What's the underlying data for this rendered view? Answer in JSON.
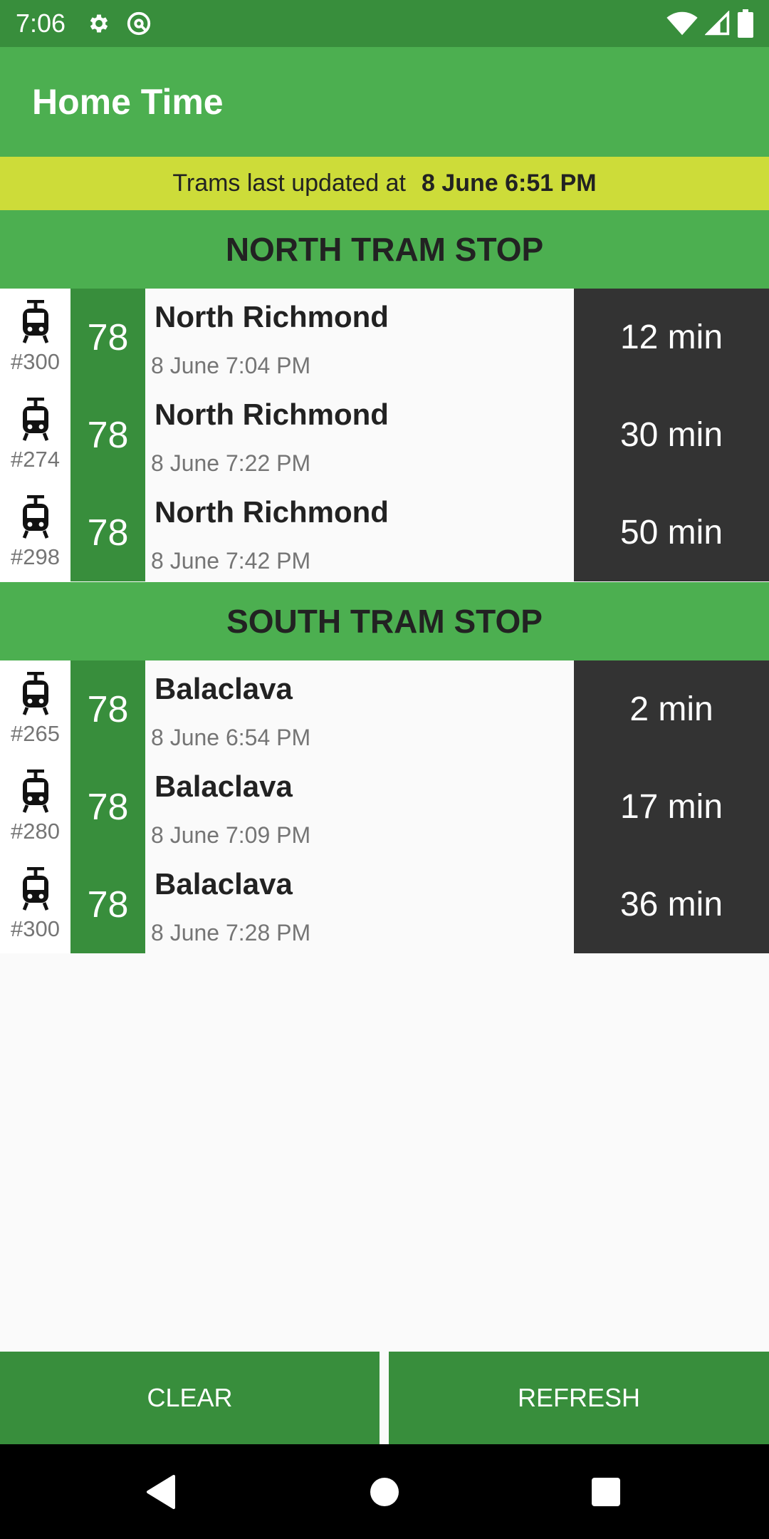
{
  "status_bar": {
    "time": "7:06",
    "left_icons": [
      "gear-icon",
      "at-sign-icon"
    ],
    "right_icons": [
      "wifi-icon",
      "signal-icon",
      "battery-icon"
    ]
  },
  "app_bar": {
    "title": "Home Time"
  },
  "banner": {
    "prefix": "Trams last updated at",
    "time": "8 June 6:51 PM"
  },
  "north": {
    "title": "NORTH TRAM STOP",
    "trams": [
      {
        "number": "#300",
        "route": "78",
        "destination": "North Richmond",
        "arrival": "8 June 7:04 PM",
        "eta": "12 min"
      },
      {
        "number": "#274",
        "route": "78",
        "destination": "North Richmond",
        "arrival": "8 June 7:22 PM",
        "eta": "30 min"
      },
      {
        "number": "#298",
        "route": "78",
        "destination": "North Richmond",
        "arrival": "8 June 7:42 PM",
        "eta": "50 min"
      }
    ]
  },
  "south": {
    "title": "SOUTH TRAM STOP",
    "trams": [
      {
        "number": "#265",
        "route": "78",
        "destination": "Balaclava",
        "arrival": "8 June 6:54 PM",
        "eta": "2 min"
      },
      {
        "number": "#280",
        "route": "78",
        "destination": "Balaclava",
        "arrival": "8 June 7:09 PM",
        "eta": "17 min"
      },
      {
        "number": "#300",
        "route": "78",
        "destination": "Balaclava",
        "arrival": "8 June 7:28 PM",
        "eta": "36 min"
      }
    ]
  },
  "buttons": {
    "clear": "CLEAR",
    "refresh": "REFRESH"
  },
  "nav_bar": {
    "icons": [
      "back-icon",
      "home-icon",
      "recents-icon"
    ]
  },
  "colors": {
    "status_bar": "#388e3c",
    "app_bar": "#4caf50",
    "banner": "#cddc39",
    "route_badge": "#388e3c",
    "eta_background": "#333333",
    "buttons": "#388e3c"
  }
}
